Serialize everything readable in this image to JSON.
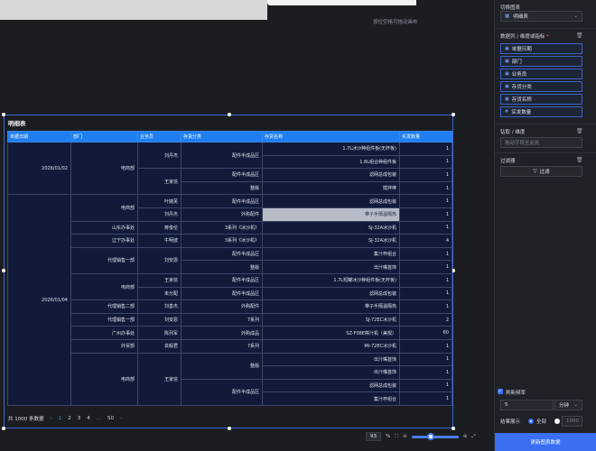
{
  "canvas": {
    "hint": "按住空格可拖动画布"
  },
  "chart": {
    "title": "明细表",
    "headers": [
      "单据日期",
      "部门",
      "业务员",
      "存货分类",
      "存货名称",
      "实发数量"
    ],
    "rows": [
      [
        "2026/01/02",
        "电商部",
        "刘丹杰",
        "配件半成品区",
        "1.7L冰沙种组件板(无杆板)",
        "1"
      ],
      [
        "",
        "",
        "",
        "",
        "1.8L组合种组件板",
        "1"
      ],
      [
        "",
        "",
        "王家信",
        "配件半成品区",
        "滤网总成包装",
        "1"
      ],
      [
        "",
        "",
        "",
        "整版",
        "搅拌棒",
        "1"
      ],
      [
        "2026/01/04",
        "电商部",
        "叶婉芙",
        "配件半成品区",
        "滤网总成包装",
        "1"
      ],
      [
        "",
        "",
        "刘丹杰",
        "外购配件",
        "带子手隔温隔热",
        "1"
      ],
      [
        "",
        "山东办事处",
        "蒋俊伦",
        "3系列《冰沙机》",
        "SJ-32A冰沙机",
        "1"
      ],
      [
        "",
        "辽宁办事处",
        "牛明波",
        "3系列《冰沙机》",
        "SJ-32A冰沙机",
        "4"
      ],
      [
        "",
        "代理销售一部",
        "刘安恩",
        "配件半成品区",
        "集汁杯组合",
        "1"
      ],
      [
        "",
        "",
        "",
        "整版",
        "出汁嘴首饰",
        "1"
      ],
      [
        "",
        "电商部",
        "王家信",
        "配件半成品区",
        "1.7L短罐冰沙种组件板(无杆板)",
        "1"
      ],
      [
        "",
        "",
        "未分配",
        "配件半成品区",
        "滤网总成包装",
        "1"
      ],
      [
        "",
        "代理销售二部",
        "刘善杰",
        "外购配件",
        "带子手隔温隔热",
        "1"
      ],
      [
        "",
        "代理销售一部",
        "刘安恩",
        "7系列",
        "SJ-72EC冰沙机",
        "2"
      ],
      [
        "",
        "广州办事处",
        "陈列军",
        "外购成品",
        "SZ-F08E榨汁机（美规）",
        "60"
      ],
      [
        "",
        "外贸部",
        "袁毅君",
        "7系列",
        "MI-72EC冰沙机",
        "1"
      ],
      [
        "",
        "电商部",
        "王家信",
        "整版",
        "出汁嘴首饰",
        "1"
      ],
      [
        "",
        "",
        "",
        "",
        "出汁嘴首饰",
        "1"
      ],
      [
        "",
        "",
        "",
        "配件半成品区",
        "滤网总成包装",
        "1"
      ],
      [
        "",
        "",
        "",
        "",
        "集汁杯组合",
        "1"
      ]
    ]
  },
  "pager": {
    "total": "共 1000 条数据",
    "prev": "‹",
    "pages": [
      "1",
      "2",
      "3",
      "4"
    ],
    "ellipsis": "...",
    "last": "50",
    "next": "›"
  },
  "zoom": {
    "value": "93",
    "unit": "%"
  },
  "sidebar": {
    "switch_label": "切换图表",
    "switch_value": "明细表",
    "fields_label": "数据列 / 维度或指标",
    "fields": [
      "单据日期",
      "部门",
      "业务员",
      "存货分类",
      "存货名称",
      "实发数量"
    ],
    "drill_label": "钻取 / 维度",
    "drill_placeholder": "拖动字段至此处",
    "filter_label": "过滤器",
    "filter_button": "过滤",
    "refresh_label": "刷新频率",
    "refresh_value": "5",
    "refresh_unit": "分钟",
    "result_label": "结果展示",
    "result_all": "全部",
    "result_limit": "1000",
    "update_button": "更新图表数据"
  },
  "colors": {
    "accent": "#1f7ff0",
    "table_bg": "#111a39",
    "primary": "#3a6ff2"
  }
}
